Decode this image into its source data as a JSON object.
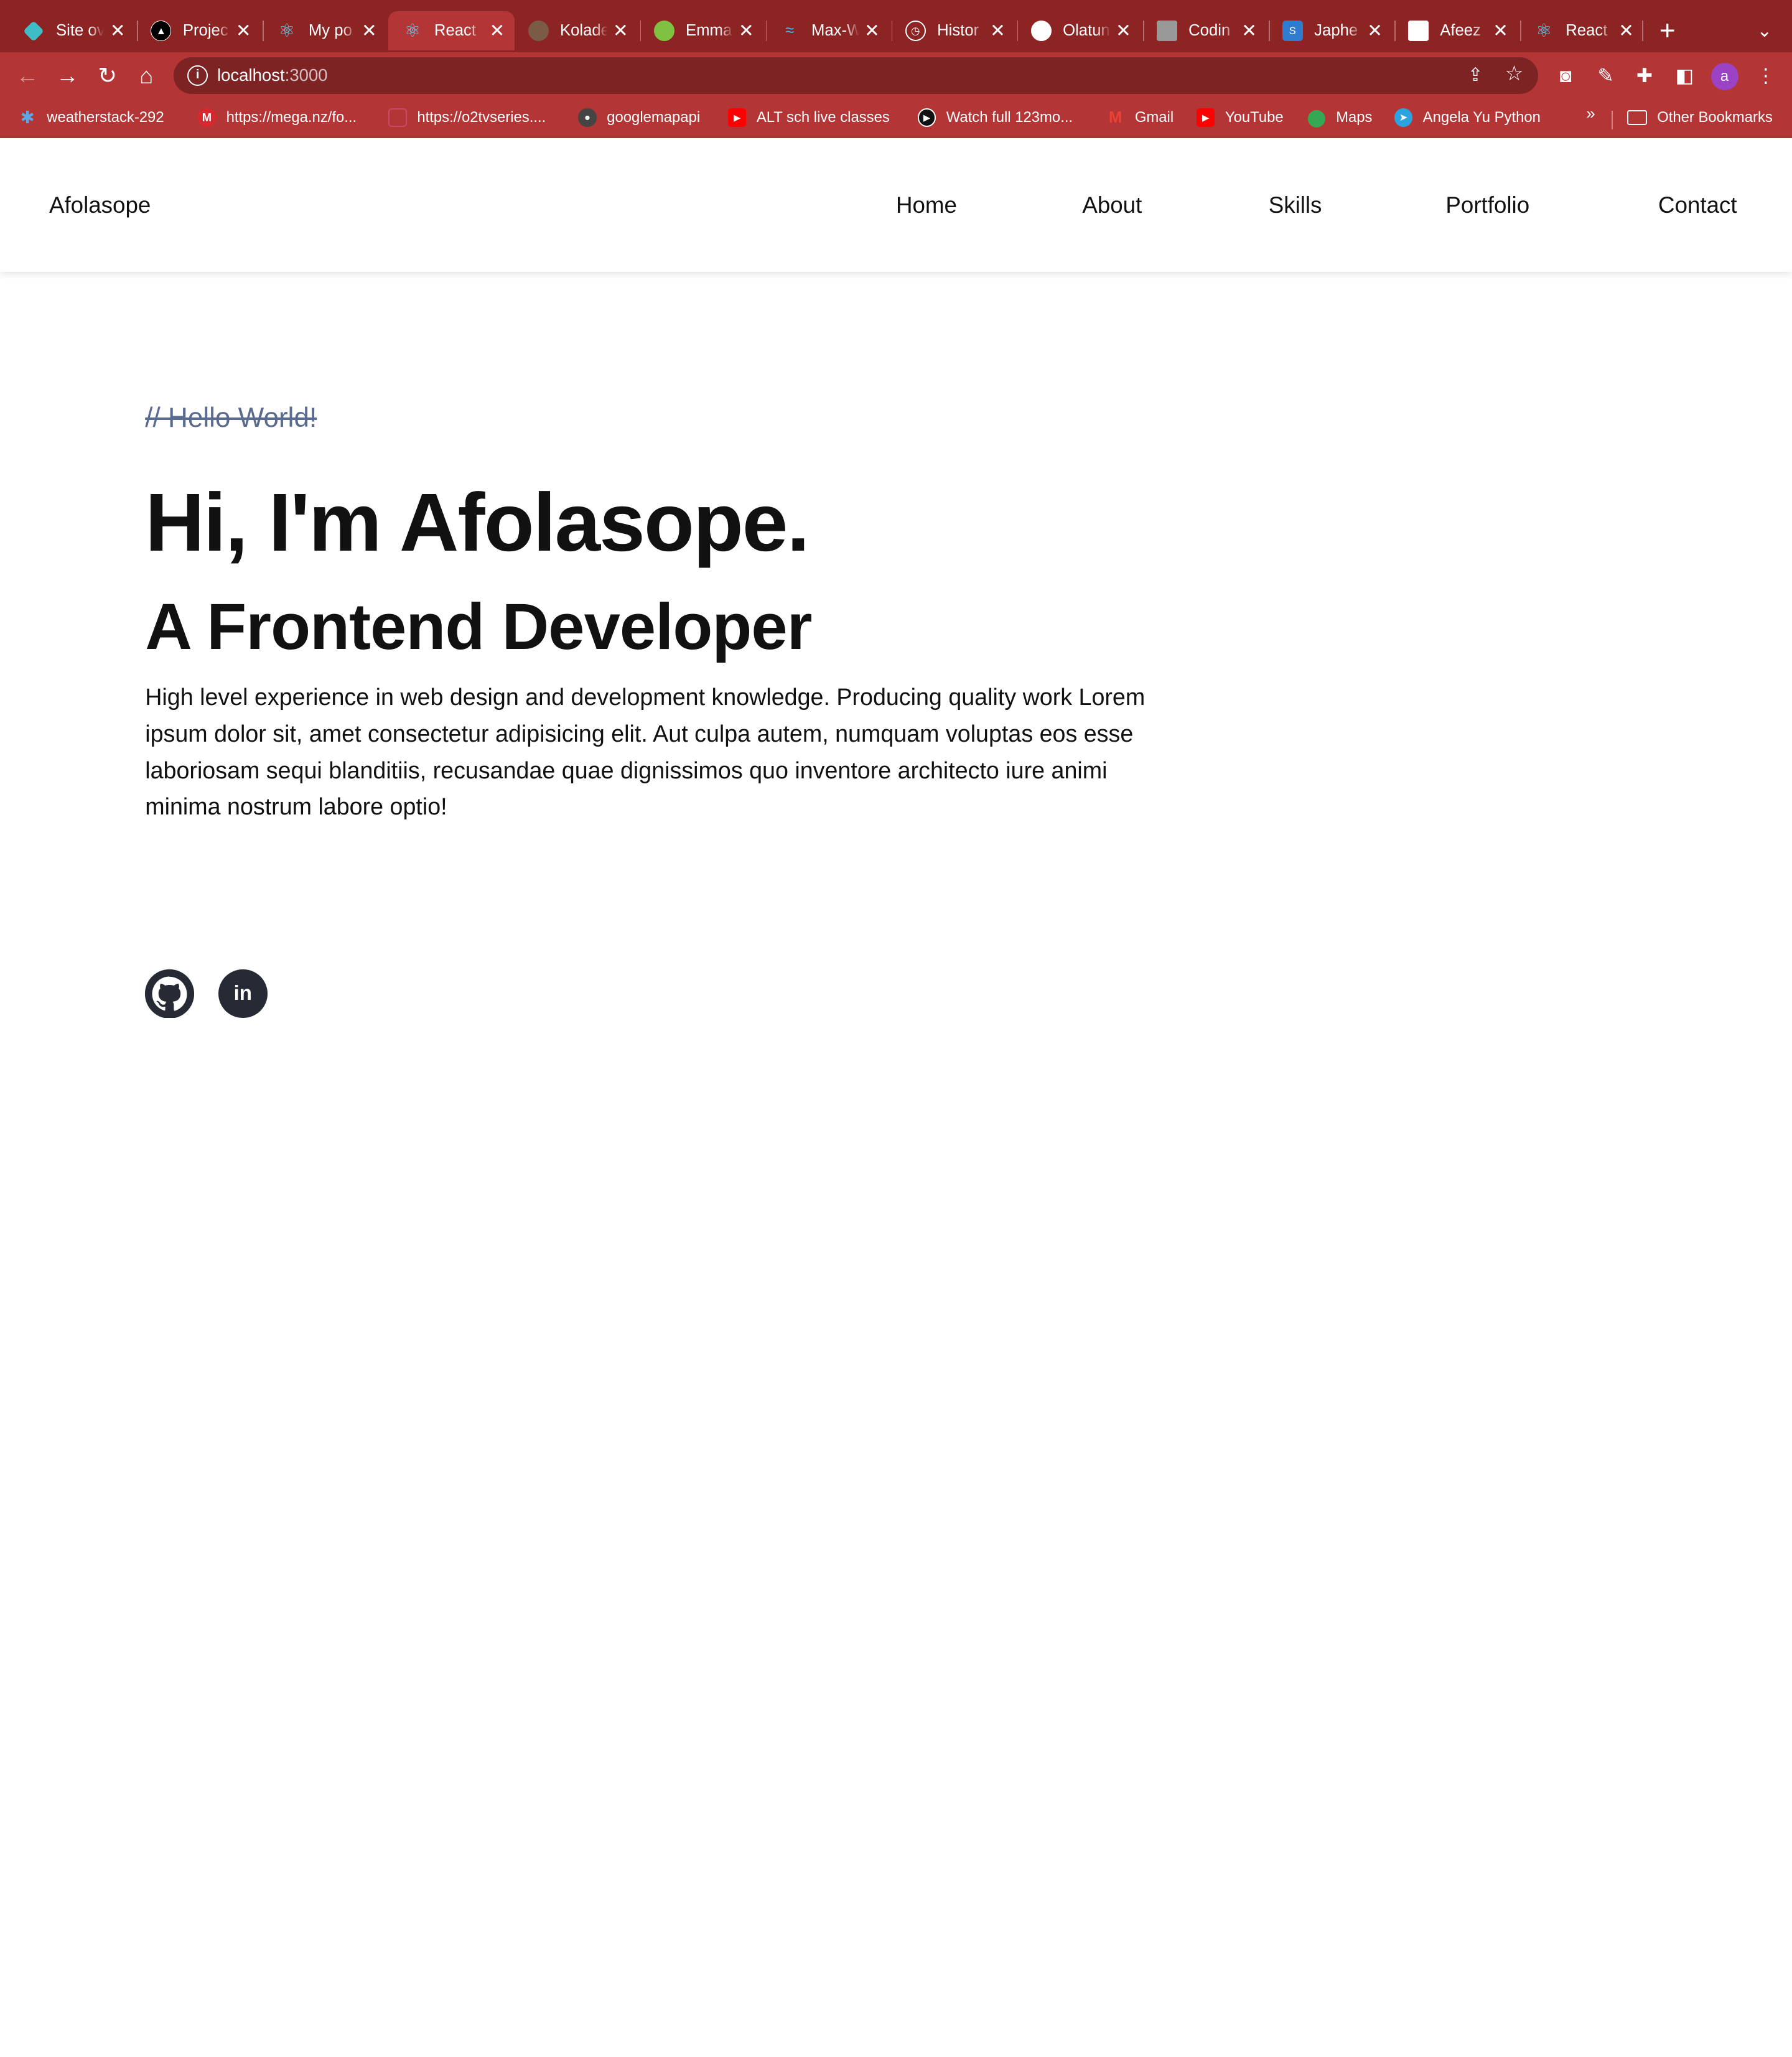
{
  "browser": {
    "tabs": [
      {
        "title": "Site ov",
        "icon": "netlify-icon",
        "color": "#3fbdc6"
      },
      {
        "title": "Projec",
        "icon": "vercel-icon",
        "color": "#000000"
      },
      {
        "title": "My po",
        "icon": "react-icon",
        "color": "#61dafb"
      },
      {
        "title": "React",
        "icon": "react-icon",
        "color": "#61dafb",
        "active": true
      },
      {
        "title": "Kolade",
        "icon": "avatar-icon",
        "color": "#7a5b45"
      },
      {
        "title": "Emma",
        "icon": "avatar-icon",
        "color": "#7fc241"
      },
      {
        "title": "Max-W",
        "icon": "tailwind-icon",
        "color": "#38bdf8"
      },
      {
        "title": "Histor",
        "icon": "history-icon",
        "color": "#ffffff"
      },
      {
        "title": "Olatun",
        "icon": "avatar-icon",
        "color": "#ffffff"
      },
      {
        "title": "Codin",
        "icon": "avatar-icon",
        "color": "#999999"
      },
      {
        "title": "Japhe",
        "icon": "site-icon",
        "color": "#2e7bcf"
      },
      {
        "title": "Afeez",
        "icon": "avatar-icon",
        "color": "#ffffff"
      },
      {
        "title": "React",
        "icon": "react-icon",
        "color": "#61dafb"
      }
    ],
    "url_host": "localhost",
    "url_port": ":3000",
    "profile_initial": "a",
    "bookmarks": [
      {
        "label": "weatherstack-292",
        "icon": "snowflake-icon",
        "color": "#5aa9e6"
      },
      {
        "label": "https://mega.nz/fo...",
        "icon": "mega-icon",
        "color": "#d9272e"
      },
      {
        "label": "https://o2tvseries....",
        "icon": "site-icon",
        "color": "#c84a6a"
      },
      {
        "label": "googlemapapi",
        "icon": "github-icon",
        "color": "#444444"
      },
      {
        "label": "ALT sch live classes",
        "icon": "youtube-icon",
        "color": "#ff0000"
      },
      {
        "label": "Watch full  123mo...",
        "icon": "play-icon",
        "color": "#111111"
      },
      {
        "label": "Gmail",
        "icon": "gmail-icon",
        "color": "#ea4335"
      },
      {
        "label": "YouTube",
        "icon": "youtube-icon",
        "color": "#ff0000"
      },
      {
        "label": "Maps",
        "icon": "maps-icon",
        "color": "#34a853"
      },
      {
        "label": "Angela Yu Python",
        "icon": "telegram-icon",
        "color": "#2aa3df"
      }
    ],
    "more_label": "»",
    "other_bookmarks": "Other Bookmarks"
  },
  "site": {
    "brand": "Afolasope",
    "nav": [
      "Home",
      "About",
      "Skills",
      "Portfolio",
      "Contact"
    ]
  },
  "hero": {
    "comment": "// Hello World!",
    "greeting": "Hi, I'm Afolasope.",
    "role": "A Frontend Developer",
    "bio": "High level experience in web design and development knowledge. Producing quality work Lorem ipsum dolor sit, amet consectetur adipisicing elit. Aut culpa autem, numquam voluptas eos esse laboriosam sequi blanditiis, recusandae quae dignissimos quo inventore architecto iure animi minima nostrum labore optio!"
  },
  "social": {
    "linkedin_text": "in"
  }
}
